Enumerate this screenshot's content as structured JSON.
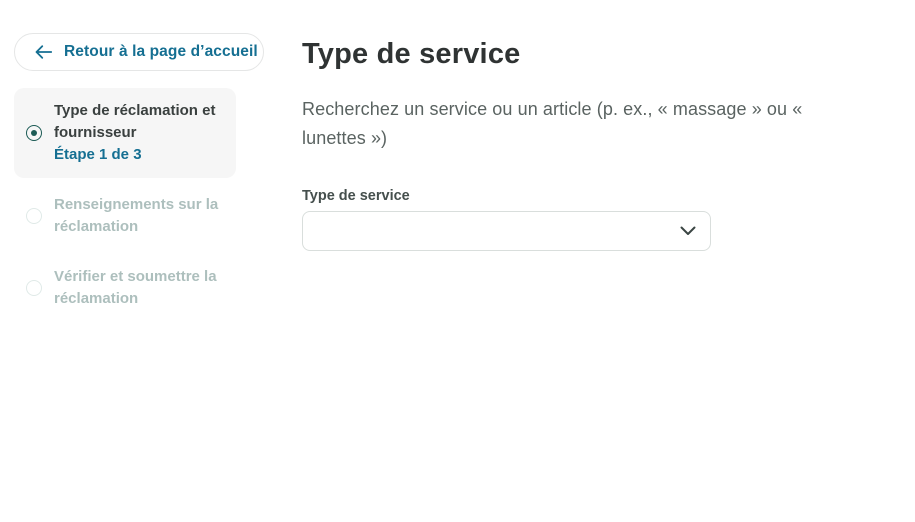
{
  "colors": {
    "link_teal": "#156f92",
    "radio_active": "#1c5b55",
    "step_title": "#3a403f",
    "step_muted": "#adbfbd",
    "active_step_bg": "#f6f6f6",
    "heading": "#2f3333",
    "body_text": "#5a6361",
    "input_border": "#d9dedc",
    "button_border": "#e5e6e6"
  },
  "back_button": {
    "label": "Retour à la page d’accueil"
  },
  "stepper": {
    "steps": [
      {
        "title": "Type de réclamation et fournisseur",
        "subtitle": "Étape 1 de 3",
        "state": "active"
      },
      {
        "title": "Renseignements sur la réclamation",
        "subtitle": "",
        "state": "upcoming"
      },
      {
        "title": "Vérifier et soumettre la réclamation",
        "subtitle": "",
        "state": "upcoming"
      }
    ]
  },
  "main": {
    "title": "Type de service",
    "description": "Recherchez un service ou un article (p. ex., « massage » ou « lunettes »)",
    "field": {
      "label": "Type de service",
      "value": ""
    }
  }
}
